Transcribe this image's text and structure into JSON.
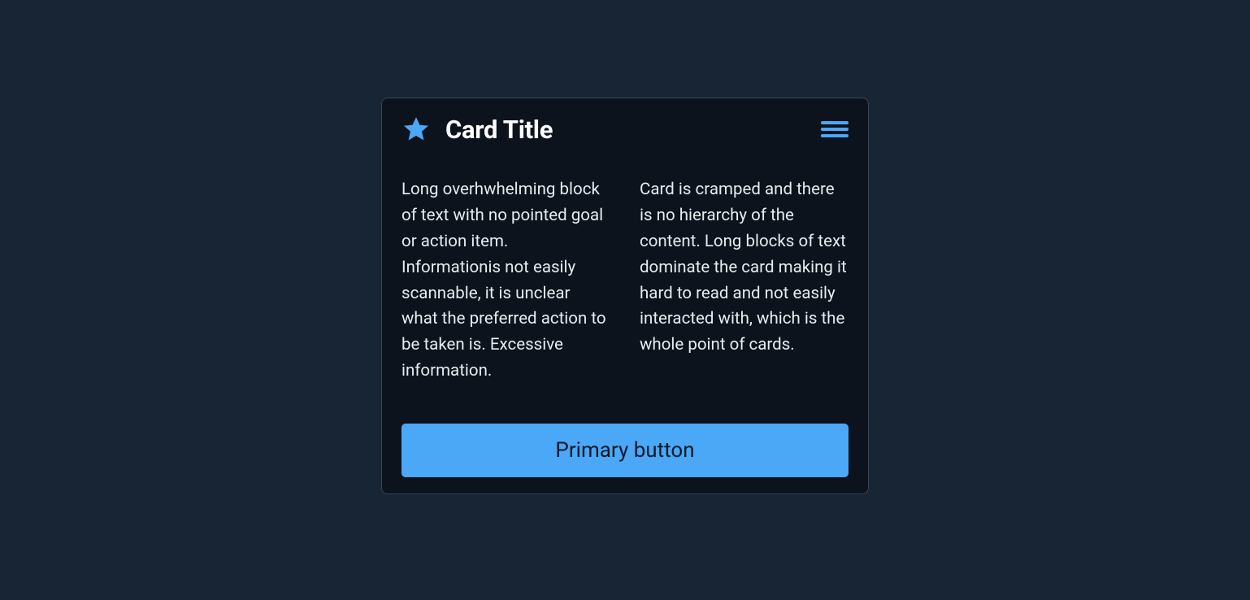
{
  "card": {
    "title": "Card Title",
    "column_left": "Long overhwhelming block of text with no pointed goal or action item. Informationis not easily scannable, it is unclear what the preferred action to be taken is. Excessive information.",
    "column_right": "Card is cramped and there is no hierarchy of the content. Long blocks of text dominate the card making it hard to read and not easily interacted with, which is the whole point of cards.",
    "button_label": "Primary button"
  },
  "colors": {
    "accent": "#4aa8f7",
    "background": "#182534",
    "card_background": "#0c131d"
  }
}
